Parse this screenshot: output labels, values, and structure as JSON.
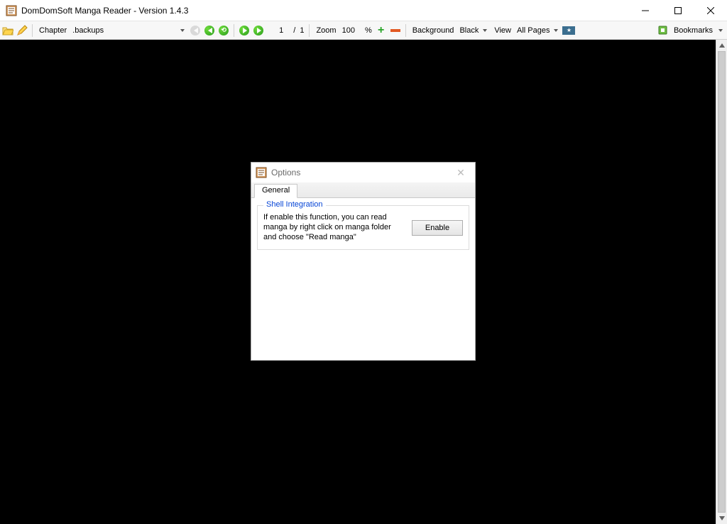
{
  "window": {
    "title": "DomDomSoft Manga Reader - Version 1.4.3"
  },
  "toolbar": {
    "chapter_label": "Chapter",
    "chapter_value": ".backups",
    "page_current": "1",
    "page_sep": "/",
    "page_total": "1",
    "zoom_label": "Zoom",
    "zoom_value": "100",
    "zoom_unit": "%",
    "background_label": "Background",
    "background_value": "Black",
    "view_label": "View",
    "view_value": "All Pages",
    "bookmarks_label": "Bookmarks"
  },
  "dialog": {
    "title": "Options",
    "tab_general": "General",
    "group_title": "Shell Integration",
    "group_desc": "If enable this function, you can read manga by right click on manga folder and choose \"Read manga\"",
    "enable_button": "Enable"
  }
}
